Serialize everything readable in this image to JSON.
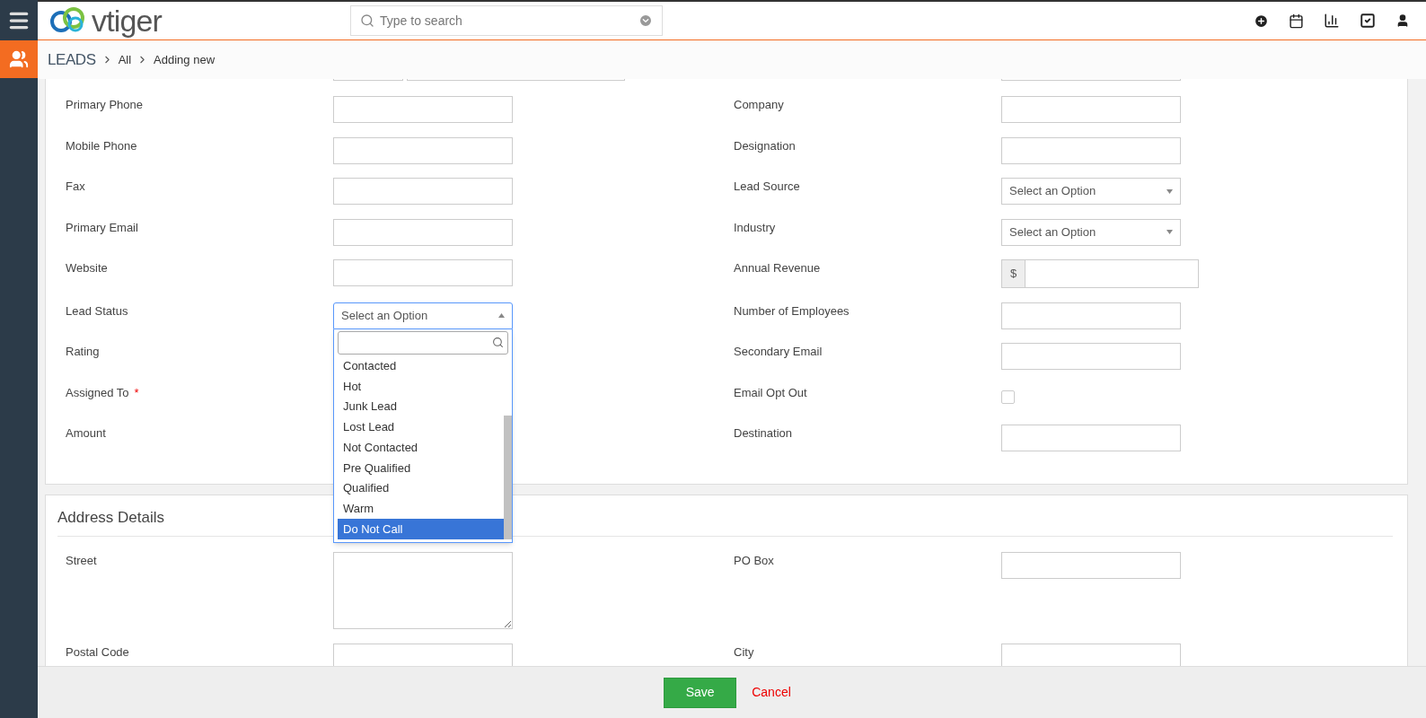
{
  "header": {
    "logo_text": "vtiger",
    "search": {
      "placeholder": "Type to search"
    }
  },
  "breadcrumb": {
    "module": "LEADS",
    "items": [
      "All",
      "Adding new"
    ]
  },
  "lead_details": {
    "rows": [
      {
        "left": {
          "label": "Primary Phone",
          "kind": "text"
        },
        "right": {
          "label": "Company",
          "kind": "text"
        }
      },
      {
        "left": {
          "label": "Mobile Phone",
          "kind": "text"
        },
        "right": {
          "label": "Designation",
          "kind": "text"
        }
      },
      {
        "left": {
          "label": "Fax",
          "kind": "text"
        },
        "right": {
          "label": "Lead Source",
          "kind": "select",
          "placeholder": "Select an Option"
        }
      },
      {
        "left": {
          "label": "Primary Email",
          "kind": "text"
        },
        "right": {
          "label": "Industry",
          "kind": "select",
          "placeholder": "Select an Option"
        }
      },
      {
        "left": {
          "label": "Website",
          "kind": "text"
        },
        "right": {
          "label": "Annual Revenue",
          "kind": "currency",
          "symbol": "$"
        }
      },
      {
        "left": {
          "label": "Lead Status",
          "kind": "select",
          "placeholder": "Select an Option",
          "expanded": true,
          "options": [
            {
              "label": "Contacted",
              "selected": false
            },
            {
              "label": "Hot",
              "selected": false
            },
            {
              "label": "Junk Lead",
              "selected": false
            },
            {
              "label": "Lost Lead",
              "selected": false
            },
            {
              "label": "Not Contacted",
              "selected": false
            },
            {
              "label": "Pre Qualified",
              "selected": false
            },
            {
              "label": "Qualified",
              "selected": false
            },
            {
              "label": "Warm",
              "selected": false
            },
            {
              "label": "Do Not Call",
              "selected": true
            }
          ]
        },
        "right": {
          "label": "Number of Employees",
          "kind": "text"
        }
      },
      {
        "left": {
          "label": "Rating"
        },
        "right": {
          "label": "Secondary Email",
          "kind": "text"
        }
      },
      {
        "left": {
          "label": "Assigned To",
          "required_mark": "*"
        },
        "right": {
          "label": "Email Opt Out",
          "kind": "checkbox",
          "checked": false
        }
      },
      {
        "left": {
          "label": "Amount"
        },
        "right": {
          "label": "Destination",
          "kind": "text"
        }
      }
    ]
  },
  "address_details": {
    "title": "Address Details",
    "rows": [
      {
        "left": {
          "label": "Street",
          "kind": "textarea"
        },
        "right": {
          "label": "PO Box",
          "kind": "text"
        }
      },
      {
        "left": {
          "label": "Postal Code",
          "kind": "text"
        },
        "right": {
          "label": "City",
          "kind": "text"
        }
      }
    ]
  },
  "footer": {
    "save": "Save",
    "cancel": "Cancel"
  }
}
